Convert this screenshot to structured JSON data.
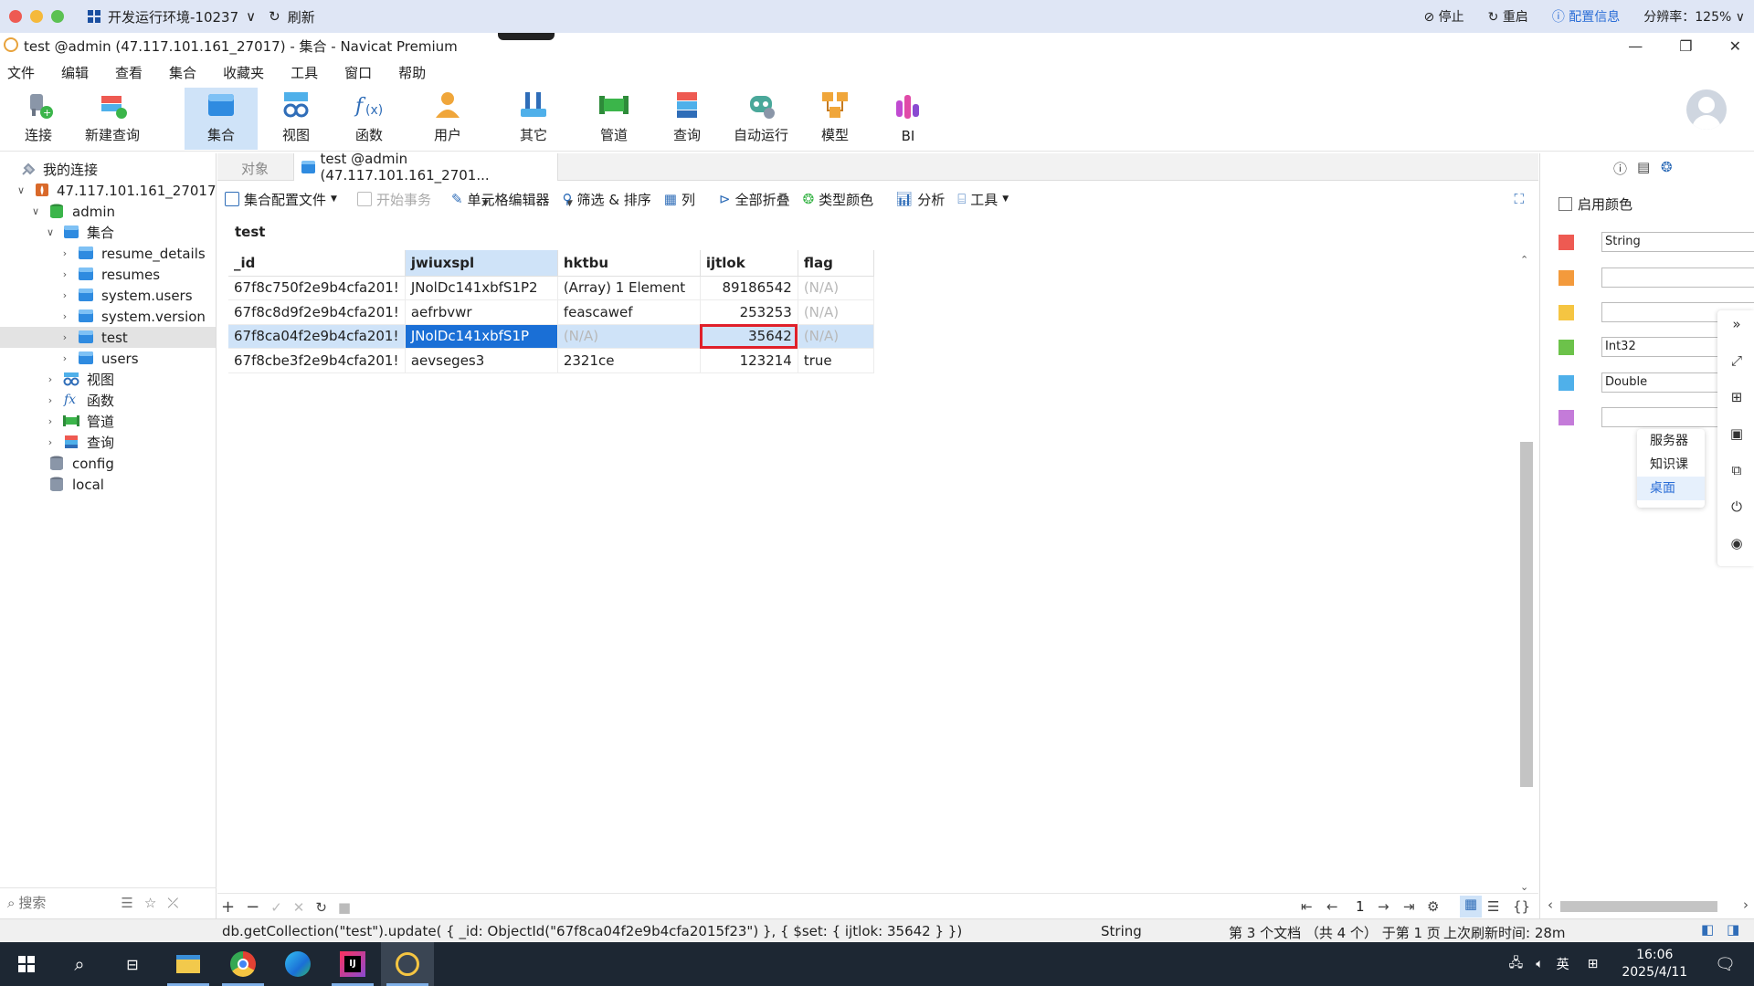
{
  "remote": {
    "env_title": "开发运行环境-10237",
    "refresh": "刷新",
    "stop": "停止",
    "restart": "重启",
    "config_info": "配置信息",
    "resolution": "分辨率：125%"
  },
  "window": {
    "title": "test @admin (47.117.101.161_27017) - 集合 - Navicat Premium"
  },
  "menu": [
    "文件",
    "编辑",
    "查看",
    "集合",
    "收藏夹",
    "工具",
    "窗口",
    "帮助"
  ],
  "toolbar": {
    "connect": "连接",
    "new_query": "新建查询",
    "collection": "集合",
    "view": "视图",
    "function": "函数",
    "user": "用户",
    "other": "其它",
    "pipeline": "管道",
    "query": "查询",
    "automation": "自动运行",
    "model": "模型",
    "bi": "BI"
  },
  "sidebar": {
    "root": "我的连接",
    "connection": "47.117.101.161_27017",
    "db_admin": "admin",
    "group_collections": "集合",
    "collections": [
      "resume_details",
      "resumes",
      "system.users",
      "system.version",
      "test",
      "users"
    ],
    "group_views": "视图",
    "group_functions": "函数",
    "group_pipelines": "管道",
    "group_queries": "查询",
    "db_config": "config",
    "db_local": "local",
    "search_placeholder": "搜索"
  },
  "tabs": {
    "objects": "对象",
    "active_tab": "test @admin (47.117.101.161_2701..."
  },
  "subtoolbar": {
    "profile": "集合配置文件",
    "begin_tx": "开始事务",
    "cell_editor": "单元格编辑器",
    "filter_sort": "筛选 & 排序",
    "columns": "列",
    "collapse_all": "全部折叠",
    "type_color": "类型颜色",
    "analyze": "分析",
    "tools": "工具"
  },
  "grid": {
    "collection_name": "test",
    "columns": [
      "_id",
      "jwiuxspl",
      "hktbu",
      "ijtlok",
      "flag"
    ],
    "rows": [
      [
        "67f8c750f2e9b4cfa201!",
        "JNolDc141xbfS1P2",
        "(Array) 1 Element",
        "89186542",
        "(N/A)"
      ],
      [
        "67f8c8d9f2e9b4cfa201!",
        "aefrbvwr",
        "feascawef",
        "253253",
        "(N/A)"
      ],
      [
        "67f8ca04f2e9b4cfa201!",
        "JNolDc141xbfS1P",
        "(N/A)",
        "35642",
        "(N/A)"
      ],
      [
        "67f8cbe3f2e9b4cfa201!",
        "aevseges3",
        "2321ce",
        "123214",
        "true"
      ]
    ],
    "page": "1"
  },
  "status": {
    "query": "db.getCollection(\"test\").update( { _id: ObjectId(\"67f8ca04f2e9b4cfa2015f23\") }, { $set: { ijtlok: 35642 } })",
    "type": "String",
    "position": "第 3 个文档 （共 4 个） 于第 1 页",
    "refresh": "上次刷新时间: 28m"
  },
  "right_panel": {
    "enable_color": "启用颜色",
    "colors": [
      {
        "color": "#ee5a52",
        "label": "String"
      },
      {
        "color": "#f39a3c",
        "label": ""
      },
      {
        "color": "#f5c542",
        "label": ""
      },
      {
        "color": "#6cc24a",
        "label": "Int32"
      },
      {
        "color": "#4fb0ea",
        "label": "Double"
      },
      {
        "color": "#c47bd9",
        "label": ""
      }
    ]
  },
  "popup": [
    "服务器",
    "知识课",
    "桌面"
  ],
  "taskbar": {
    "time": "16:06",
    "date": "2025/4/11",
    "ime": "英"
  }
}
